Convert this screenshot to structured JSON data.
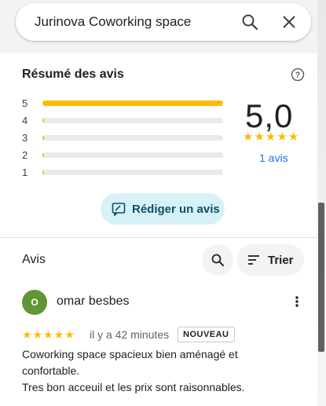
{
  "search": {
    "query": "Jurinova Coworking space",
    "search_icon": "search-icon",
    "close_icon": "close-icon"
  },
  "summary": {
    "title": "Résumé des avis",
    "help_icon": "help-circle-icon",
    "bars": [
      {
        "label": "5",
        "fraction": 1.0
      },
      {
        "label": "4",
        "fraction": 0.008
      },
      {
        "label": "3",
        "fraction": 0.008
      },
      {
        "label": "2",
        "fraction": 0.008
      },
      {
        "label": "1",
        "fraction": 0.008
      }
    ],
    "score": "5,0",
    "stars": "★★★★★",
    "count_label": "1 avis",
    "write_button": "Rédiger un avis"
  },
  "reviews_section": {
    "title": "Avis",
    "sort_label": "Trier"
  },
  "review": {
    "avatar_letter": "O",
    "author": "omar besbes",
    "stars": "★★★★★",
    "time": "il y a 42 minutes",
    "badge": "NOUVEAU",
    "lines": [
      "Coworking space spacieux bien aménagé et",
      "confortable.",
      "Tres bon acceuil et les prix sont raisonnables."
    ]
  },
  "colors": {
    "star": "#fbbc04",
    "link": "#1a73e8",
    "write_button_bg": "#d7f2f6",
    "avatar_bg": "#5f9636"
  }
}
